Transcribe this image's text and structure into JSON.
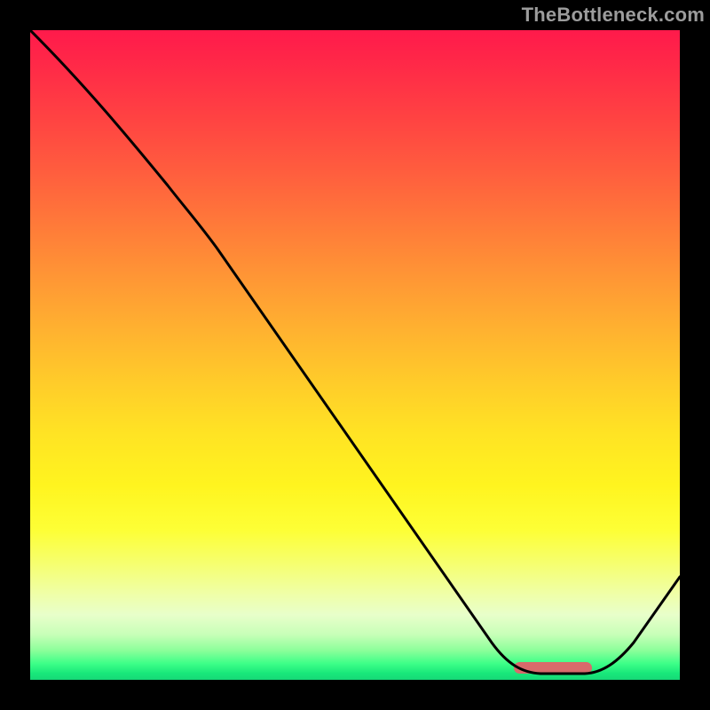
{
  "watermark": "TheBottleneck.com",
  "chart_data": {
    "type": "line",
    "title": "",
    "xlabel": "",
    "ylabel": "",
    "xlim": [
      0,
      1
    ],
    "ylim": [
      0,
      1
    ],
    "series": [
      {
        "name": "curve",
        "points": [
          {
            "x": 0.0,
            "y": 1.0
          },
          {
            "x": 0.21,
            "y": 0.76
          },
          {
            "x": 0.73,
            "y": 0.03
          },
          {
            "x": 0.78,
            "y": 0.01
          },
          {
            "x": 0.86,
            "y": 0.01
          },
          {
            "x": 1.0,
            "y": 0.16
          }
        ]
      }
    ],
    "marker": {
      "x_start": 0.745,
      "x_end": 0.865,
      "y": 0.015,
      "color": "#d86b6b"
    },
    "gradient_note": "vertical red→orange→yellow→green heatmap background"
  }
}
